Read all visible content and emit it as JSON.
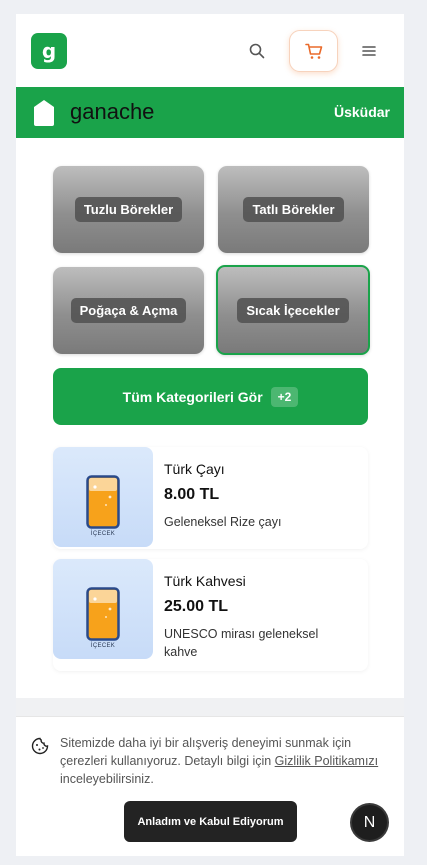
{
  "header": {
    "logo_letter": "g",
    "icons": {
      "search": "search-icon",
      "cart": "cart-icon",
      "menu": "menu-icon"
    },
    "accent_color": "#1aa34a",
    "cart_color": "#ea6a2a"
  },
  "store": {
    "name": "ganache",
    "location": "Üsküdar"
  },
  "categories": [
    {
      "label": "Tuzlu Börekler",
      "active": false
    },
    {
      "label": "Tatlı Börekler",
      "active": false
    },
    {
      "label": "Poğaça & Açma",
      "active": false
    },
    {
      "label": "Sıcak İçecekler",
      "active": true
    }
  ],
  "all_categories": {
    "label": "Tüm Kategorileri Gör",
    "badge": "+2"
  },
  "products": [
    {
      "name": "Türk Çayı",
      "price": "8.00 TL",
      "description": "Geleneksel Rize çayı",
      "thumb_caption": "İÇECEK"
    },
    {
      "name": "Türk Kahvesi",
      "price": "25.00 TL",
      "description": "UNESCO mirası geleneksel kahve",
      "thumb_caption": "İÇECEK"
    }
  ],
  "cookie": {
    "text_before": "Sitemizde daha iyi bir alışveriş deneyimi sunmak için çerezleri kullanıyoruz. Detaylı bilgi için ",
    "link": "Gizlilik Politikamızı",
    "text_after": " inceleyebilirsiniz.",
    "accept_label": "Anladım ve Kabul Ediyorum",
    "floating_badge": "N"
  }
}
